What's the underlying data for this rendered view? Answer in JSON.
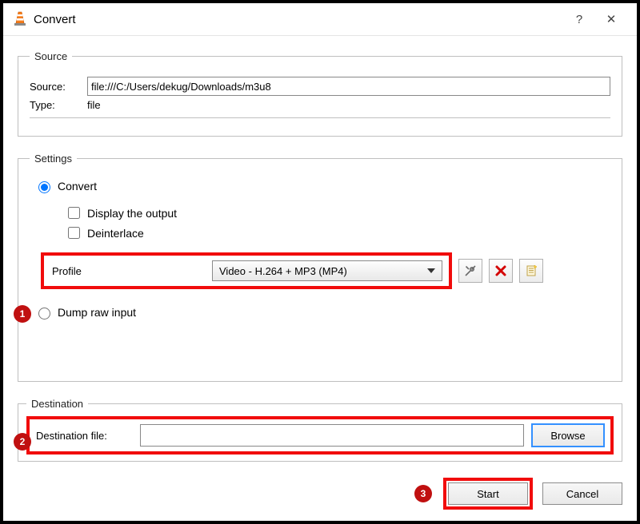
{
  "window": {
    "title": "Convert",
    "help_label": "?",
    "close_label": "✕"
  },
  "source_group": {
    "legend": "Source",
    "source_label": "Source:",
    "source_value": "file:///C:/Users/dekug/Downloads/m3u8",
    "type_label": "Type:",
    "type_value": "file"
  },
  "settings_group": {
    "legend": "Settings",
    "convert_label": "Convert",
    "display_output_label": "Display the output",
    "deinterlace_label": "Deinterlace",
    "profile_label": "Profile",
    "profile_value": "Video - H.264 + MP3 (MP4)",
    "tools_icon_name": "settings-tools-icon",
    "delete_icon_name": "delete-profile-icon",
    "new_icon_name": "new-profile-icon",
    "dump_raw_label": "Dump raw input"
  },
  "destination_group": {
    "legend": "Destination",
    "dest_label": "Destination file:",
    "dest_value": "",
    "browse_label": "Browse"
  },
  "footer": {
    "start_label": "Start",
    "cancel_label": "Cancel"
  },
  "annotations": {
    "step1": "1",
    "step2": "2",
    "step3": "3"
  }
}
